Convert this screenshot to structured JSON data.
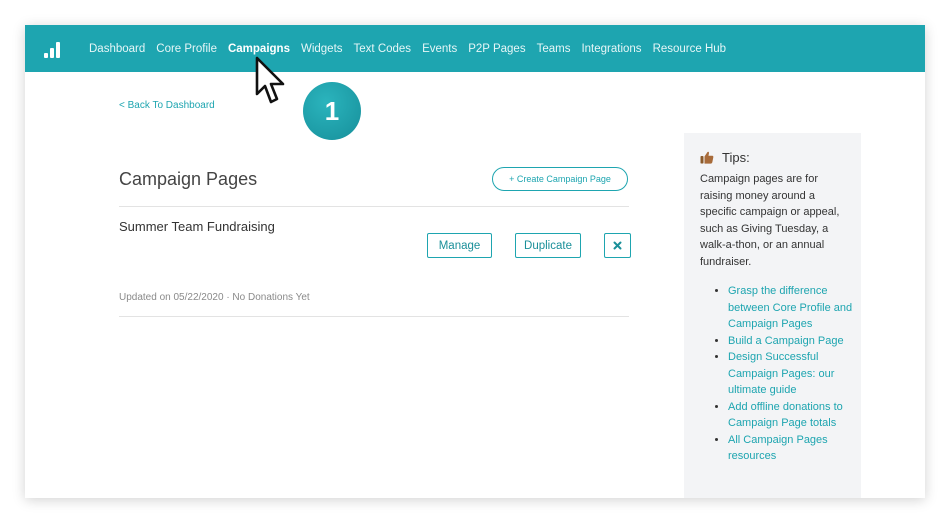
{
  "nav": {
    "items": [
      {
        "label": "Dashboard"
      },
      {
        "label": "Core Profile"
      },
      {
        "label": "Campaigns"
      },
      {
        "label": "Widgets"
      },
      {
        "label": "Text Codes"
      },
      {
        "label": "Events"
      },
      {
        "label": "P2P Pages"
      },
      {
        "label": "Teams"
      },
      {
        "label": "Integrations"
      },
      {
        "label": "Resource Hub"
      }
    ],
    "active_item": "Campaigns",
    "background_color": "#1ea5b0"
  },
  "back_link": "< Back To Dashboard",
  "page_title": "Campaign Pages",
  "create_button": "+ Create Campaign Page",
  "campaign": {
    "name": "Summer Team Fundraising",
    "manage_label": "Manage",
    "duplicate_label": "Duplicate",
    "delete_icon": "close-icon",
    "updated_text": "Updated on 05/22/2020 · No Donations Yet"
  },
  "tips": {
    "icon": "thumbs-up-icon",
    "title": "Tips:",
    "body": "Campaign pages are for raising money around a specific campaign or appeal, such as Giving Tuesday, a walk-a-thon, or an annual fundraiser.",
    "links": [
      "Grasp the difference between Core Profile and Campaign Pages",
      "Build a Campaign Page",
      "Design Successful Campaign Pages: our ultimate guide",
      "Add offline donations to Campaign Page totals",
      "All Campaign Pages resources"
    ]
  },
  "step_badge": "1",
  "accent_color": "#1ea5b0"
}
